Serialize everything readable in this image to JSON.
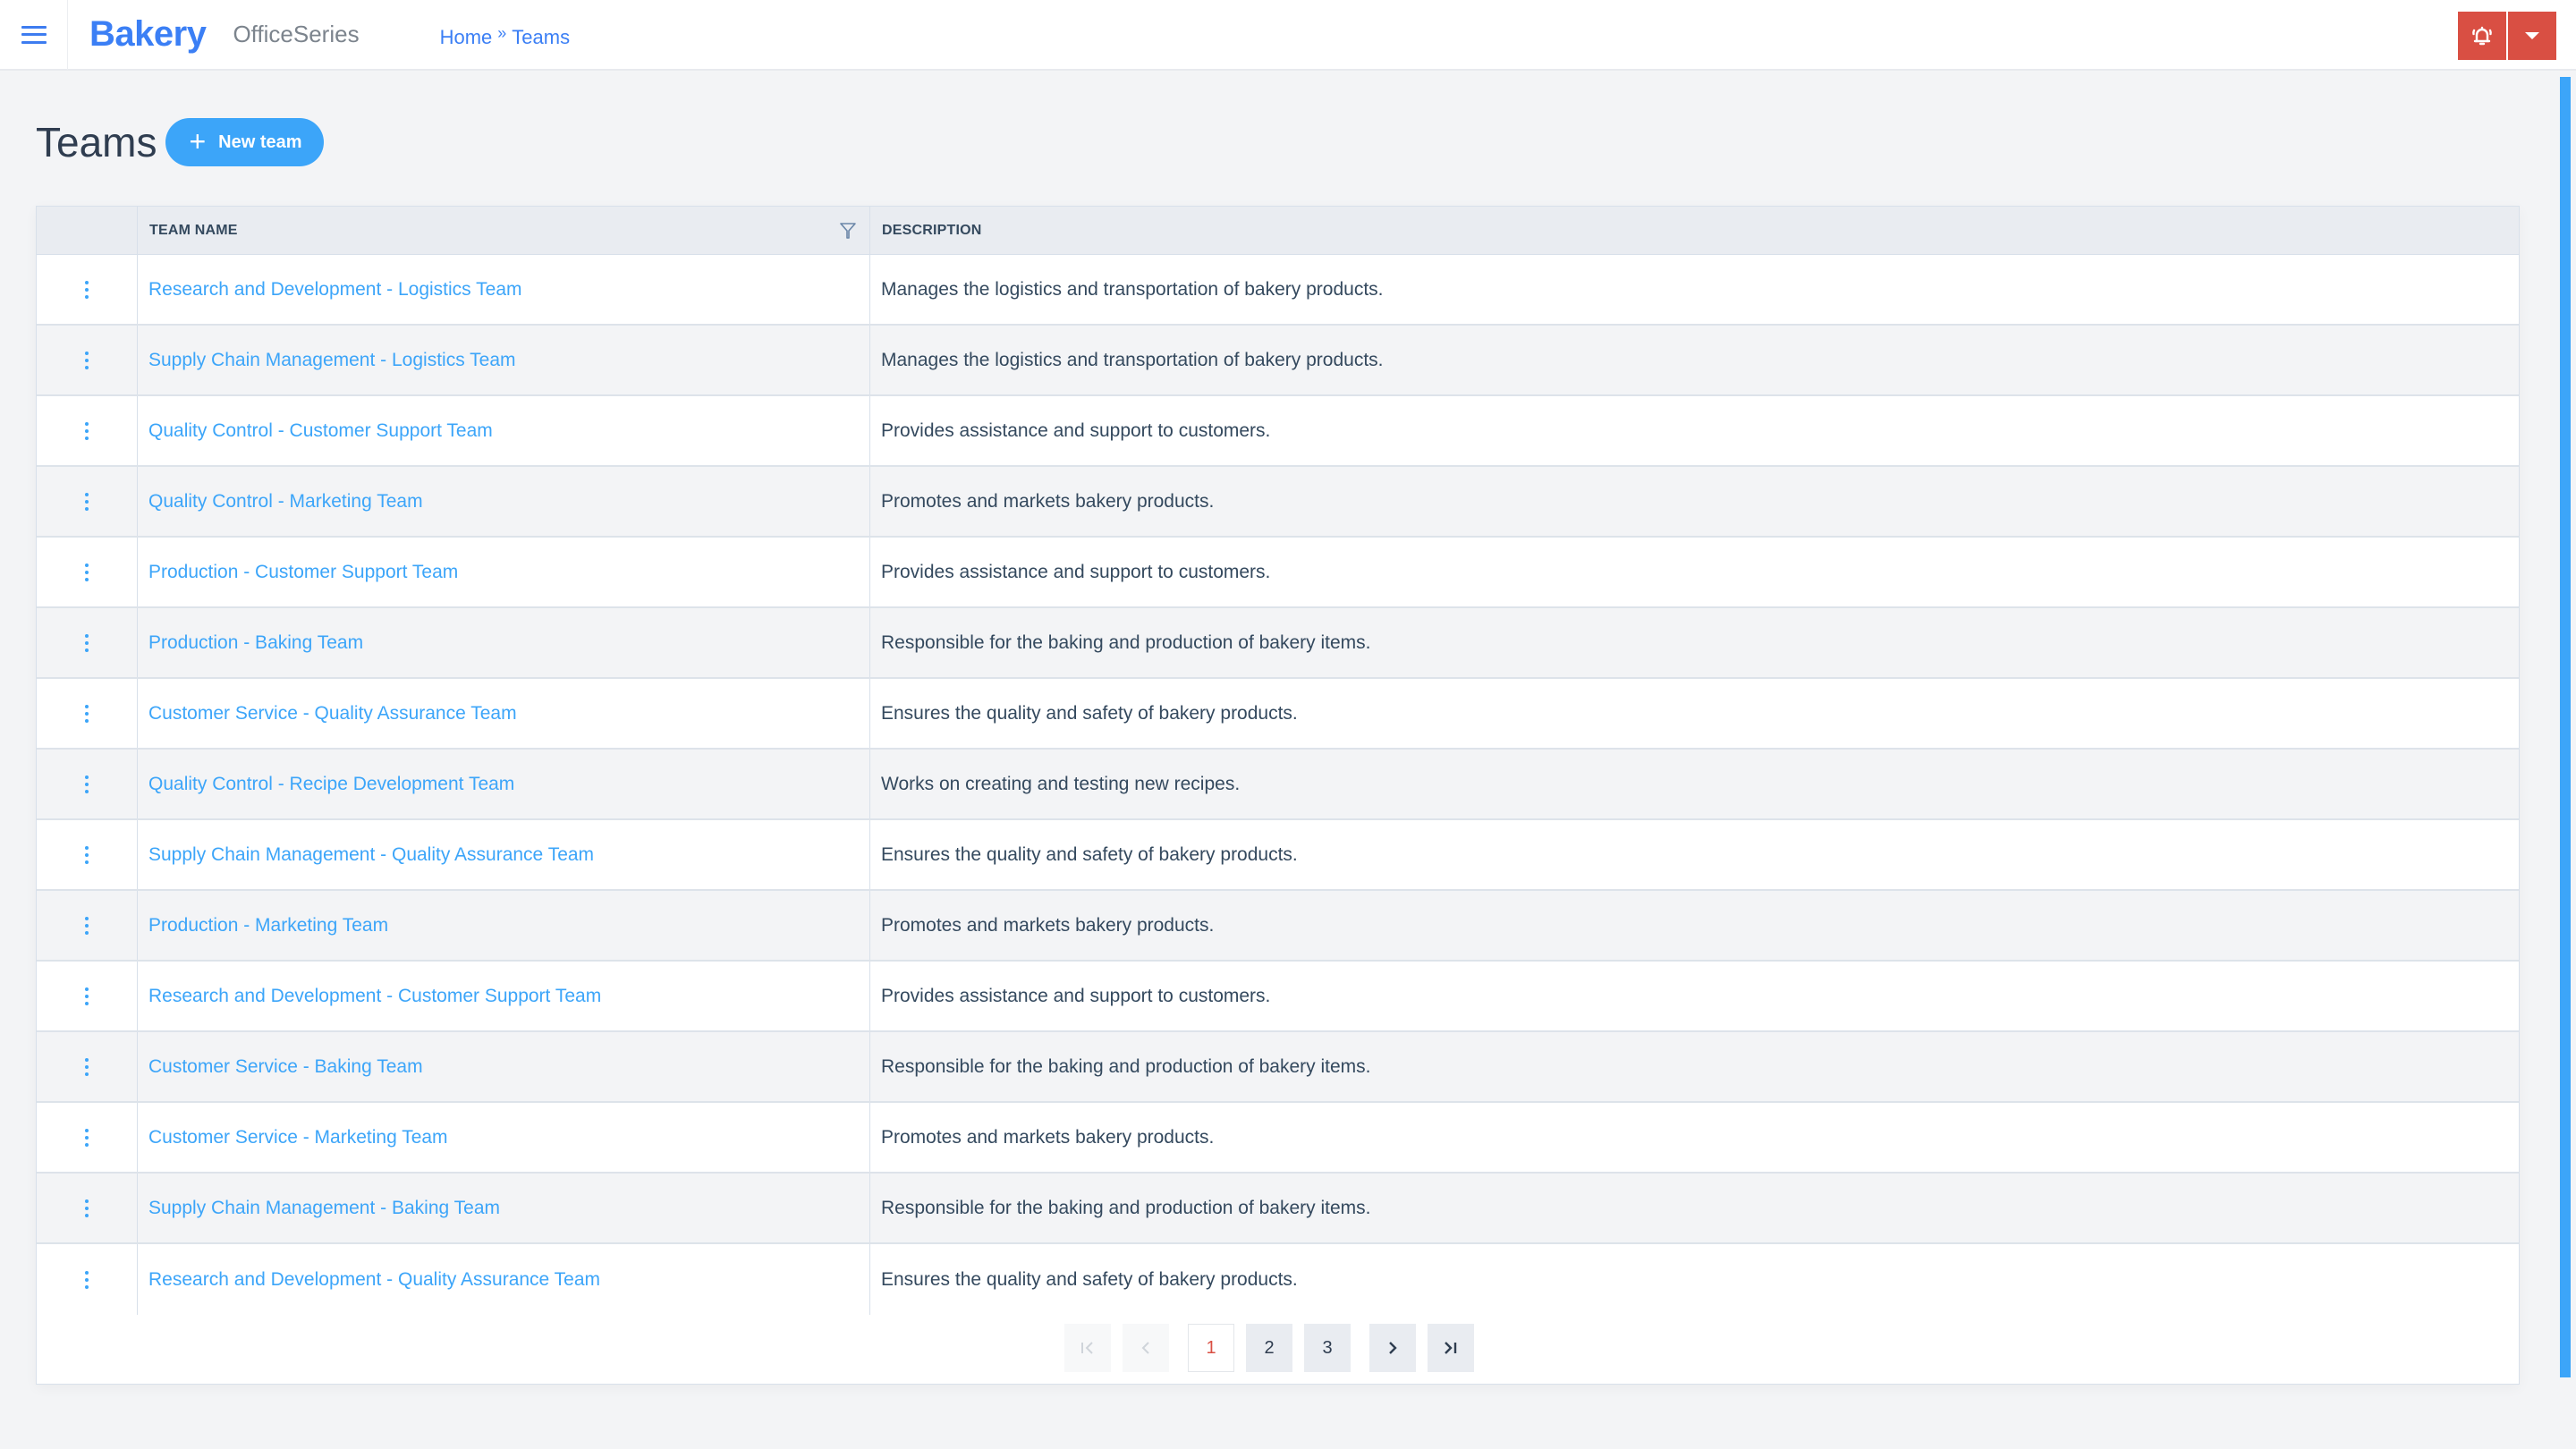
{
  "app": {
    "brand": "Bakery",
    "product": "OfficeSeries"
  },
  "breadcrumb": {
    "items": [
      "Home",
      "Teams"
    ],
    "separator": "»"
  },
  "header_actions": {
    "notifications_icon": "bell-ringing-icon",
    "menu_icon": "caret-down-icon"
  },
  "page": {
    "title": "Teams",
    "new_button_label": "New team"
  },
  "table": {
    "columns": [
      "",
      "TEAM NAME",
      "DESCRIPTION"
    ],
    "rows": [
      {
        "name": "Research and Development - Logistics Team",
        "description": "Manages the logistics and transportation of bakery products."
      },
      {
        "name": "Supply Chain Management - Logistics Team",
        "description": "Manages the logistics and transportation of bakery products."
      },
      {
        "name": "Quality Control - Customer Support Team",
        "description": "Provides assistance and support to customers."
      },
      {
        "name": "Quality Control - Marketing Team",
        "description": "Promotes and markets bakery products."
      },
      {
        "name": "Production - Customer Support Team",
        "description": "Provides assistance and support to customers."
      },
      {
        "name": "Production - Baking Team",
        "description": "Responsible for the baking and production of bakery items."
      },
      {
        "name": "Customer Service - Quality Assurance Team",
        "description": "Ensures the quality and safety of bakery products."
      },
      {
        "name": "Quality Control - Recipe Development Team",
        "description": "Works on creating and testing new recipes."
      },
      {
        "name": "Supply Chain Management - Quality Assurance Team",
        "description": "Ensures the quality and safety of bakery products."
      },
      {
        "name": "Production - Marketing Team",
        "description": "Promotes and markets bakery products."
      },
      {
        "name": "Research and Development - Customer Support Team",
        "description": "Provides assistance and support to customers."
      },
      {
        "name": "Customer Service - Baking Team",
        "description": "Responsible for the baking and production of bakery items."
      },
      {
        "name": "Customer Service - Marketing Team",
        "description": "Promotes and markets bakery products."
      },
      {
        "name": "Supply Chain Management - Baking Team",
        "description": "Responsible for the baking and production of bakery items."
      },
      {
        "name": "Research and Development - Quality Assurance Team",
        "description": "Ensures the quality and safety of bakery products."
      }
    ]
  },
  "pagination": {
    "first_label": "|<",
    "prev_label": "<",
    "pages": [
      "1",
      "2",
      "3"
    ],
    "current_page": "1",
    "next_label": ">",
    "last_label": ">|"
  },
  "colors": {
    "brand": "#3b7ff5",
    "accent": "#3ca5f9",
    "danger": "#d94f43",
    "text": "#34495e"
  }
}
